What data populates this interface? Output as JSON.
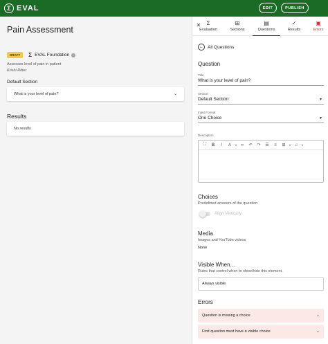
{
  "app": {
    "logo_mark": "Σ",
    "logo_text": "EVAL"
  },
  "toolbar": {
    "edit_label": "EDIT",
    "publish_label": "PUBLISH"
  },
  "assessment": {
    "title": "Pain Assessment",
    "status_badge": "DRAFT",
    "org_icon": "Σ",
    "org_name": "EVAL Foundation",
    "description": "Assesses level of pain in patient",
    "author": "Krishi Ritter",
    "section_label": "Default Section",
    "question_text": "What is your level of pain?",
    "results_heading": "Results",
    "results_empty": "No results"
  },
  "tabs": [
    {
      "label": "Evaluation",
      "icon": "sigma-icon",
      "glyph": "Σ"
    },
    {
      "label": "Sections",
      "icon": "grid-icon",
      "glyph": "⊞"
    },
    {
      "label": "Questions",
      "icon": "chat-icon",
      "glyph": "▤"
    },
    {
      "label": "Results",
      "icon": "check-icon",
      "glyph": "✓"
    },
    {
      "label": "Errors",
      "icon": "error-icon",
      "glyph": "▣"
    }
  ],
  "active_tab": "Questions",
  "close_glyph": "✕",
  "editor": {
    "back_label": "All Questions",
    "heading": "Question",
    "title_label": "Title",
    "title_value": "What is your level of pain?",
    "section_label": "Section",
    "section_value": "Default Section",
    "input_format_label": "Input Format",
    "input_format_value": "One Choice",
    "description_label": "Description",
    "choices_heading": "Choices",
    "choices_sub": "Predefined answers of the question",
    "align_label": "Align Vertically",
    "media_heading": "Media",
    "media_sub": "Images and YouTube videos",
    "media_value": "None",
    "visible_heading": "Visible When...",
    "visible_sub": "Rules that control when to show/hide this element.",
    "visible_value": "Always visible",
    "errors_heading": "Errors",
    "errors": [
      "Question is missing a choice",
      "First question must have a visible choice"
    ]
  },
  "colors": {
    "brand": "#1b6b26",
    "error": "#d32f2f",
    "error_bg": "#fde8e8",
    "draft": "#f7c948"
  }
}
